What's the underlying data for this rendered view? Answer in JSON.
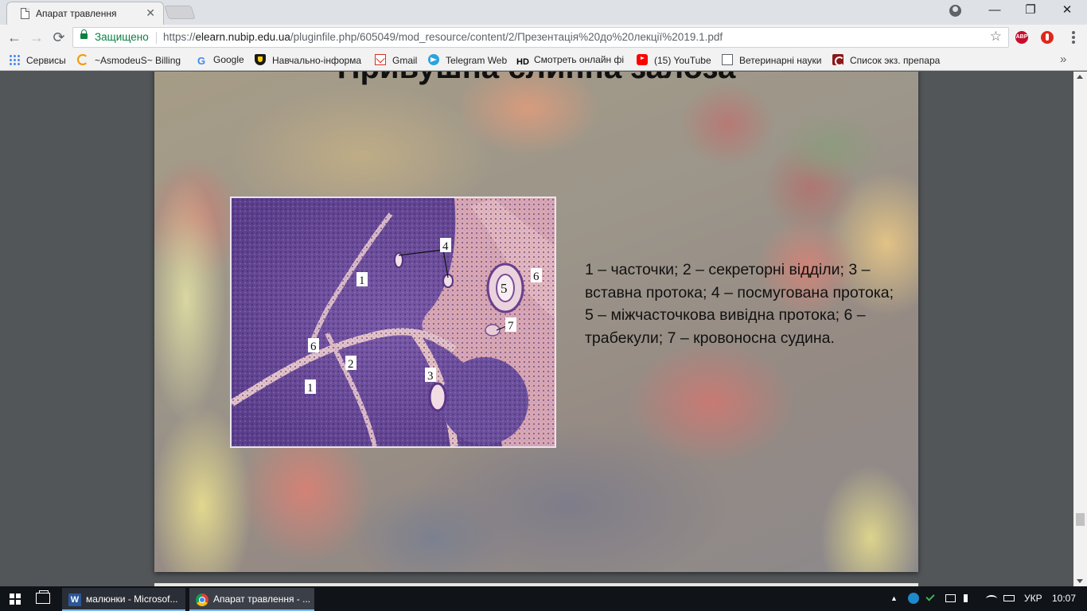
{
  "browser": {
    "tab": {
      "title": "Апарат травлення",
      "close": "✕"
    },
    "window_controls": {
      "minimize": "—",
      "maximize": "❐",
      "close": "✕"
    },
    "nav": {
      "back": "←",
      "forward": "→",
      "reload": "⟳"
    },
    "address": {
      "security_label": "Защищено",
      "scheme": "https://",
      "host": "elearn.nubip.edu.ua",
      "path": "/pluginfile.php/605049/mod_resource/content/2/Презентація%20до%20лекції%2019.1.pdf"
    },
    "bookmark_star": "☆",
    "extensions": {
      "abp_label": "ABP"
    },
    "bookmarks": [
      {
        "label": "Сервисы",
        "icon": "apps-grid-icon"
      },
      {
        "label": "~AsmodeuS~ Billing",
        "icon": "c-logo-icon"
      },
      {
        "label": "Google",
        "icon": "google-icon"
      },
      {
        "label": "Навчально-інформа",
        "icon": "shield-icon"
      },
      {
        "label": "Gmail",
        "icon": "gmail-icon"
      },
      {
        "label": "Telegram Web",
        "icon": "telegram-icon"
      },
      {
        "label": "Смотреть онлайн фі",
        "icon": "hd-icon",
        "icon_text": "HD"
      },
      {
        "label": "(15) YouTube",
        "icon": "youtube-icon"
      },
      {
        "label": "Ветеринарні науки",
        "icon": "page-icon"
      },
      {
        "label": "Список экз. препара",
        "icon": "list-icon"
      }
    ],
    "bookmarks_more": "»"
  },
  "slide": {
    "title": "Привушна слинна залоза",
    "caption": "1 – часточки; 2 – секреторні відділи; 3 – вставна протока; 4 – посмугована протока; 5 – міжчасточкова вивідна протока; 6 –трабекули; 7 – кровоносна судина.",
    "micrograph_labels": [
      "1",
      "2",
      "3",
      "4",
      "5",
      "6",
      "7",
      "1",
      "6"
    ]
  },
  "taskbar": {
    "apps": [
      {
        "label": "малюнки - Microsof...",
        "icon": "word-icon",
        "icon_text": "W"
      },
      {
        "label": "Апарат травлення - ...",
        "icon": "chrome-icon"
      }
    ],
    "tray": {
      "chevron": "▲",
      "language": "УКР",
      "time": "10:07"
    }
  }
}
